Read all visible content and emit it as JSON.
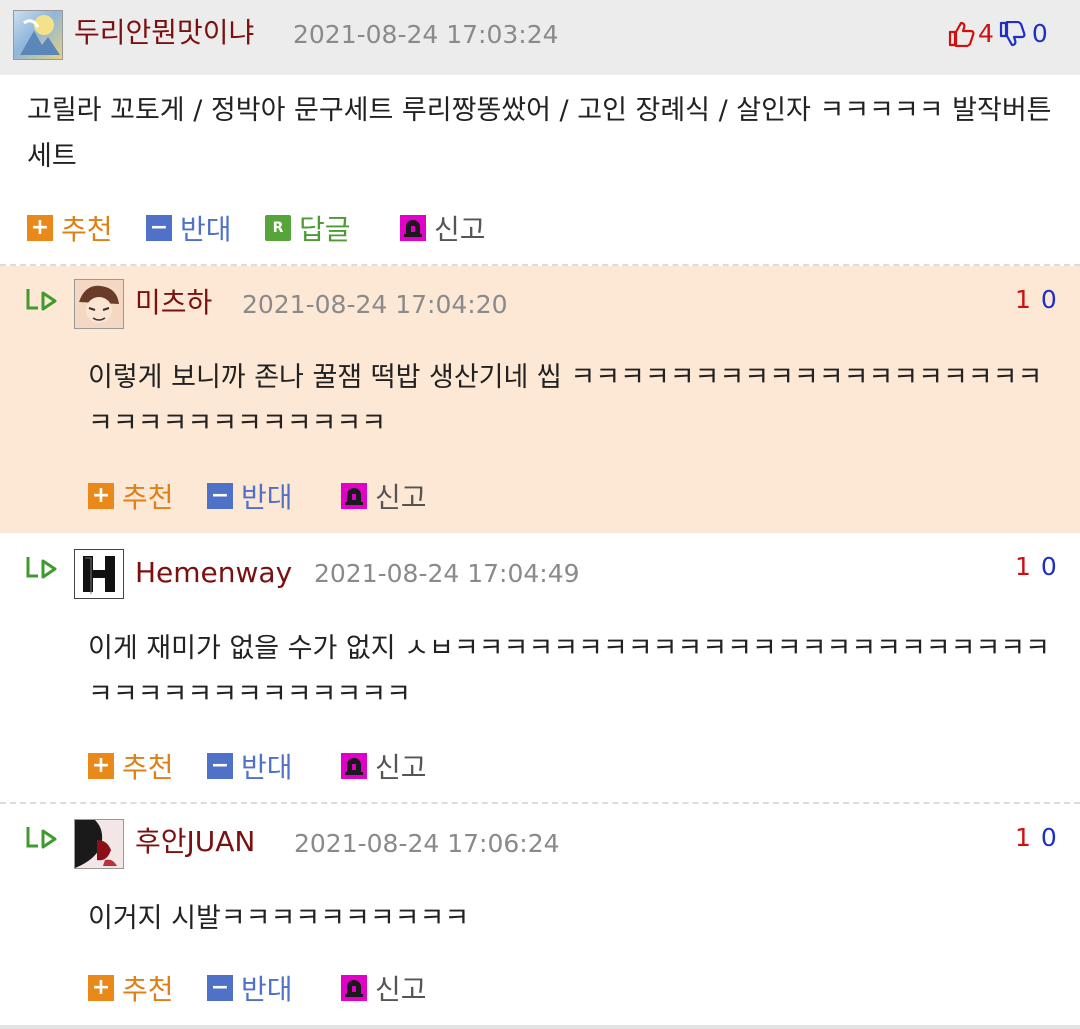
{
  "main_comment": {
    "nickname": "두리안뭔맛이냐",
    "date": "2021-08-24 17:03:24",
    "upvotes": "4",
    "downvotes": "0",
    "body": "고릴라 꼬토게 / 정박아 문구세트 루리짱똥쌌어 / 고인 장례식 / 살인자 ㅋㅋㅋㅋㅋ 발작버튼세트",
    "actions": {
      "recommend": "추천",
      "oppose": "반대",
      "reply": "답글",
      "report": "신고"
    }
  },
  "replies": [
    {
      "nickname": "미츠하",
      "date": "2021-08-24 17:04:20",
      "up": "1",
      "down": "0",
      "body": "이렇게 보니까 존나 꿀잼 떡밥 생산기네 씹 ㅋㅋㅋㅋㅋㅋㅋㅋㅋㅋㅋㅋㅋㅋㅋㅋㅋㅋㅋㅋㅋㅋㅋㅋㅋㅋㅋㅋㅋㅋㅋ",
      "actions": {
        "recommend": "추천",
        "oppose": "반대",
        "report": "신고"
      }
    },
    {
      "nickname": "Hemenway",
      "date": "2021-08-24 17:04:49",
      "up": "1",
      "down": "0",
      "body": "이게 재미가 없을 수가 없지 ㅅㅂㅋㅋㅋㅋㅋㅋㅋㅋㅋㅋㅋㅋㅋㅋㅋㅋㅋㅋㅋㅋㅋㅋㅋㅋㅋㅋㅋㅋㅋㅋㅋㅋㅋㅋㅋㅋㅋ",
      "actions": {
        "recommend": "추천",
        "oppose": "반대",
        "report": "신고"
      }
    },
    {
      "nickname": "후안JUAN",
      "date": "2021-08-24 17:06:24",
      "up": "1",
      "down": "0",
      "body": "이거지 시발ㅋㅋㅋㅋㅋㅋㅋㅋㅋㅋ",
      "actions": {
        "recommend": "추천",
        "oppose": "반대",
        "report": "신고"
      }
    }
  ],
  "colors": {
    "nickname": "#7a1010",
    "reply_highlight_bg": "#fde8d6",
    "upvote": "#d01010",
    "downvote": "#1d2fc7",
    "recommend": "#df8016",
    "oppose": "#4f72c8",
    "reply": "#4e9a36",
    "reply_arrow": "#3f9a2f"
  },
  "icons": {
    "thumbs_up": "thumbs-up-icon",
    "thumbs_down": "thumbs-down-icon",
    "plus": "plus-icon",
    "minus": "minus-icon",
    "reply": "reply-r-icon",
    "report": "siren-icon",
    "reply_arrow": "reply-arrow-icon"
  }
}
